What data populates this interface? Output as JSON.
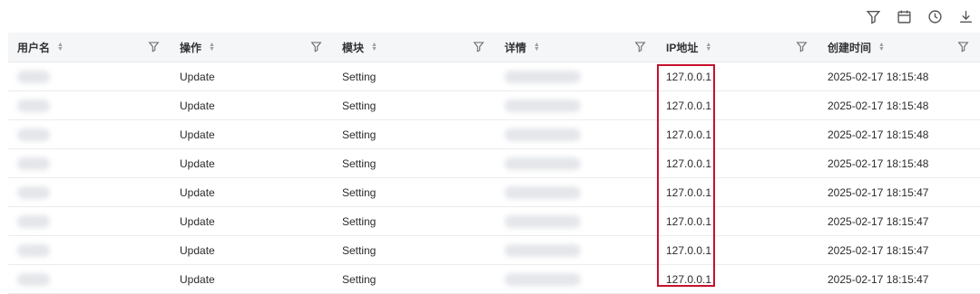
{
  "toolbar": {
    "icons": [
      "filter-icon",
      "calendar-icon",
      "history-icon",
      "download-icon"
    ]
  },
  "table": {
    "columns": [
      {
        "label": "用户名"
      },
      {
        "label": "操作"
      },
      {
        "label": "模块"
      },
      {
        "label": "详情"
      },
      {
        "label": "IP地址"
      },
      {
        "label": "创建时间"
      }
    ],
    "rows": [
      {
        "operation": "Update",
        "module": "Setting",
        "ip": "127.0.0.1",
        "created": "2025-02-17 18:15:48"
      },
      {
        "operation": "Update",
        "module": "Setting",
        "ip": "127.0.0.1",
        "created": "2025-02-17 18:15:48"
      },
      {
        "operation": "Update",
        "module": "Setting",
        "ip": "127.0.0.1",
        "created": "2025-02-17 18:15:48"
      },
      {
        "operation": "Update",
        "module": "Setting",
        "ip": "127.0.0.1",
        "created": "2025-02-17 18:15:48"
      },
      {
        "operation": "Update",
        "module": "Setting",
        "ip": "127.0.0.1",
        "created": "2025-02-17 18:15:47"
      },
      {
        "operation": "Update",
        "module": "Setting",
        "ip": "127.0.0.1",
        "created": "2025-02-17 18:15:47"
      },
      {
        "operation": "Update",
        "module": "Setting",
        "ip": "127.0.0.1",
        "created": "2025-02-17 18:15:47"
      },
      {
        "operation": "Update",
        "module": "Setting",
        "ip": "127.0.0.1",
        "created": "2025-02-17 18:15:47"
      }
    ]
  },
  "colors": {
    "highlight": "#c8102e",
    "header_bg": "#f5f6f8"
  }
}
